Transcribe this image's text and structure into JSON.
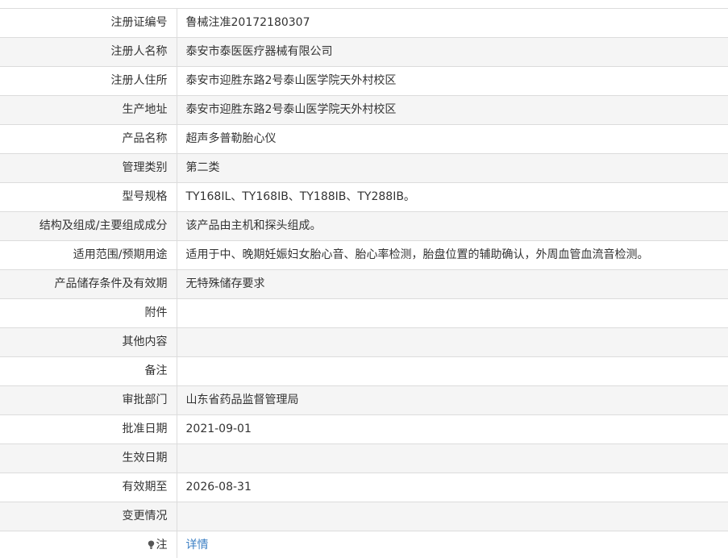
{
  "rows": [
    {
      "label": "注册证编号",
      "value": "鲁械注准20172180307"
    },
    {
      "label": "注册人名称",
      "value": "泰安市泰医医疗器械有限公司"
    },
    {
      "label": "注册人住所",
      "value": "泰安市迎胜东路2号泰山医学院天外村校区"
    },
    {
      "label": "生产地址",
      "value": "泰安市迎胜东路2号泰山医学院天外村校区"
    },
    {
      "label": "产品名称",
      "value": "超声多普勒胎心仪"
    },
    {
      "label": "管理类别",
      "value": "第二类"
    },
    {
      "label": "型号规格",
      "value": "TY168IL、TY168IB、TY188IB、TY288IB。"
    },
    {
      "label": "结构及组成/主要组成成分",
      "value": "该产品由主机和探头组成。"
    },
    {
      "label": "适用范围/预期用途",
      "value": "适用于中、晚期妊娠妇女胎心音、胎心率检测，胎盘位置的辅助确认，外周血管血流音检测。"
    },
    {
      "label": "产品储存条件及有效期",
      "value": "无特殊储存要求"
    },
    {
      "label": "附件",
      "value": ""
    },
    {
      "label": "其他内容",
      "value": ""
    },
    {
      "label": "备注",
      "value": ""
    },
    {
      "label": "审批部门",
      "value": "山东省药品监督管理局"
    },
    {
      "label": "批准日期",
      "value": "2021-09-01"
    },
    {
      "label": "生效日期",
      "value": ""
    },
    {
      "label": "有效期至",
      "value": "2026-08-31"
    },
    {
      "label": "变更情况",
      "value": ""
    }
  ],
  "note": {
    "label": "注",
    "link_text": "详情",
    "icon": "bulb-icon"
  },
  "colors": {
    "link": "#3b7fc4",
    "alt_row_bg": "#f5f5f5",
    "border": "#dcdcdc",
    "text": "#333333"
  }
}
